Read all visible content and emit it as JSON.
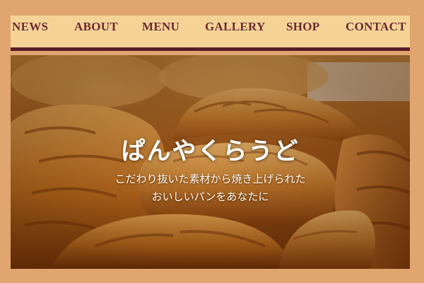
{
  "nav": {
    "items": [
      {
        "label": "NEWS"
      },
      {
        "label": "ABOUT"
      },
      {
        "label": "MENU"
      },
      {
        "label": "GALLERY"
      },
      {
        "label": "SHOP"
      },
      {
        "label": "CONTACT"
      }
    ]
  },
  "hero": {
    "title": "ぱんやくらうど",
    "tagline_line1": "こだわり抜いた素材から焼き上げられた",
    "tagline_line2": "おいしいパンをあなたに"
  },
  "colors": {
    "page_background": "#e1a66f",
    "header_background": "#f5d397",
    "nav_text": "#6b2a32",
    "header_rule": "#5b1c27",
    "hero_text": "#ffffff"
  }
}
